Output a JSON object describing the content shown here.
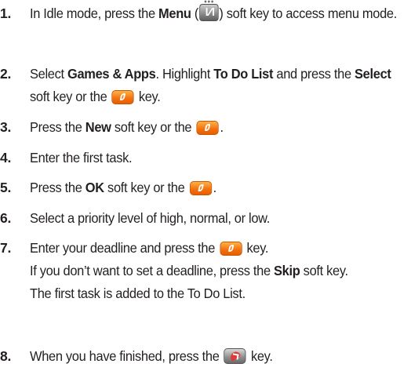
{
  "steps": [
    {
      "num": "1.",
      "t1": "In Idle mode, press the ",
      "b1": "Menu",
      "t2": " (",
      "t3": ") soft key to access menu mode."
    },
    {
      "num": "2.",
      "t1": "Select ",
      "b1": "Games & Apps",
      "t2": ". Highlight ",
      "b2": "To Do List",
      "t3": " and press the ",
      "b3": "Select",
      "t4": " soft key or the ",
      "t5": " key."
    },
    {
      "num": "3.",
      "t1": "Press the ",
      "b1": "New",
      "t2": " soft key or the ",
      "t3": "."
    },
    {
      "num": "4.",
      "t1": "Enter the first task."
    },
    {
      "num": "5.",
      "t1": "Press the ",
      "b1": "OK",
      "t2": " soft key or the ",
      "t3": "."
    },
    {
      "num": "6.",
      "t1": "Select a priority level of high, normal, or low."
    },
    {
      "num": "7.",
      "t1": "Enter your deadline and press the ",
      "t2": " key.",
      "t3": "If you don’t want to set a deadline, press the ",
      "b1": "Skip",
      "t4": " soft key.",
      "t5": "The first task is added to the To Do List."
    },
    {
      "num": "8.",
      "t1": "When you have finished, press the ",
      "t2": " key."
    }
  ],
  "icons": {
    "menu": "menu-key-icon",
    "ok": "ok-key-icon",
    "end": "end-key-icon"
  },
  "colors": {
    "text": "#231f20",
    "ok_key": "#f26f0d",
    "end_key_symbol": "#e23a3a"
  }
}
